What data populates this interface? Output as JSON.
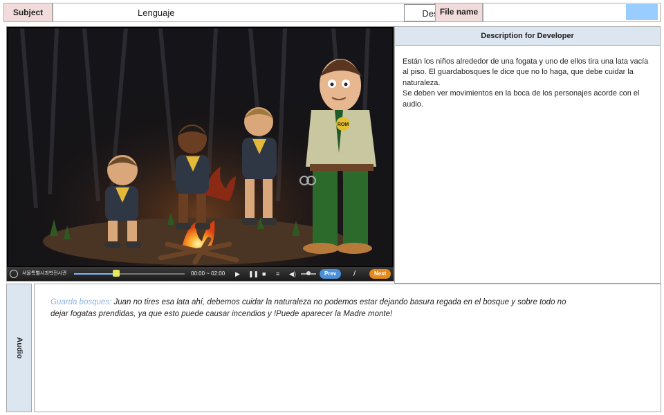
{
  "header": {
    "subject_label": "Subject",
    "subject_value": "Lenguaje",
    "stage": "Desarrollo",
    "file_label": "File name",
    "file_value": "",
    "swatch_color": "#99ccff"
  },
  "player": {
    "org_name": "서울특별시과학전시관",
    "time": "00:00 ~ 02:00",
    "progress_fraction": 0.38,
    "prev_label": "Prev",
    "separator": "/",
    "next_label": "Next",
    "badge_text": "ROM",
    "accent_prev": "#4a8fd8",
    "accent_next": "#e48a1c"
  },
  "description": {
    "title": "Description for Developer",
    "paragraphs": [
      "Están los niños alrededor de una fogata y uno de ellos tira una lata vacía al piso. El guardabosques le dice que no lo haga, que debe cuidar la naturaleza.",
      "Se deben ver movimientos en la boca de los personajes acorde con el audio."
    ]
  },
  "audio": {
    "label": "Audio",
    "speaker": "Guarda bosques:",
    "line": "Juan no tires esa lata ahí, debemos cuidar la naturaleza no podemos estar dejando basura regada en el bosque y sobre todo no dejar fogatas prendidas, ya que esto puede causar incendios y !Puede aparecer la Madre monte!"
  }
}
